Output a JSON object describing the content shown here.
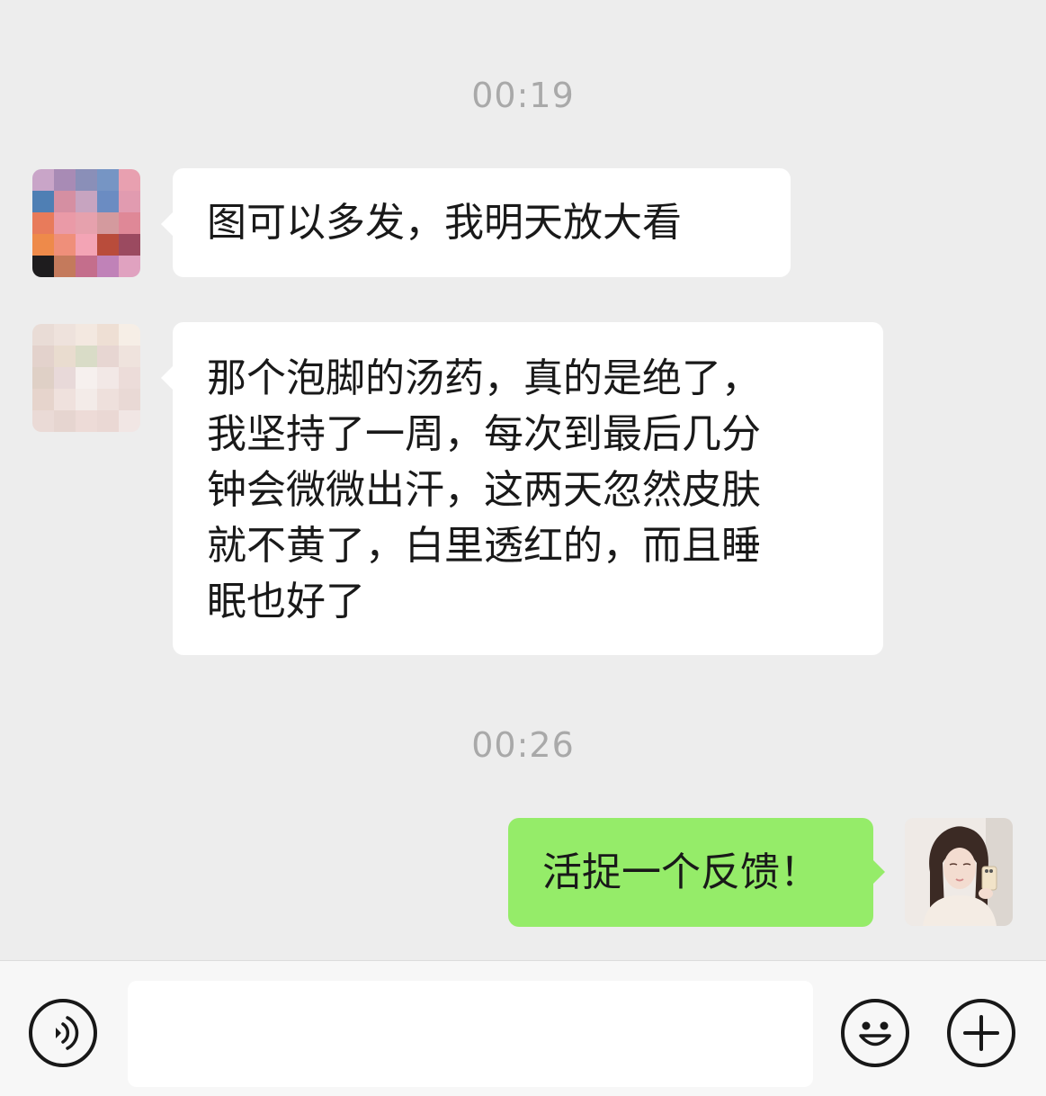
{
  "chat": {
    "timestamp_1": "00:19",
    "timestamp_2": "00:26",
    "messages": [
      {
        "side": "left",
        "text": "图可以多发，我明天放大看"
      },
      {
        "side": "left",
        "lines": [
          "那个泡脚的汤药，真的是绝了，",
          "我坚持了一周，每次到最后几分",
          "钟会微微出汗，这两天忽然皮肤",
          "就不黄了，白里透红的，而且睡",
          "眠也好了"
        ]
      },
      {
        "side": "right",
        "text": "活捉一个反馈！"
      }
    ]
  },
  "input_bar": {
    "voice_icon": "voice-icon",
    "emoji_icon": "emoji-icon",
    "plus_icon": "plus-icon",
    "input_value": ""
  },
  "colors": {
    "background": "#ededed",
    "incoming_bubble": "#ffffff",
    "outgoing_bubble": "#95ec69",
    "timestamp": "#a9a9a9"
  }
}
